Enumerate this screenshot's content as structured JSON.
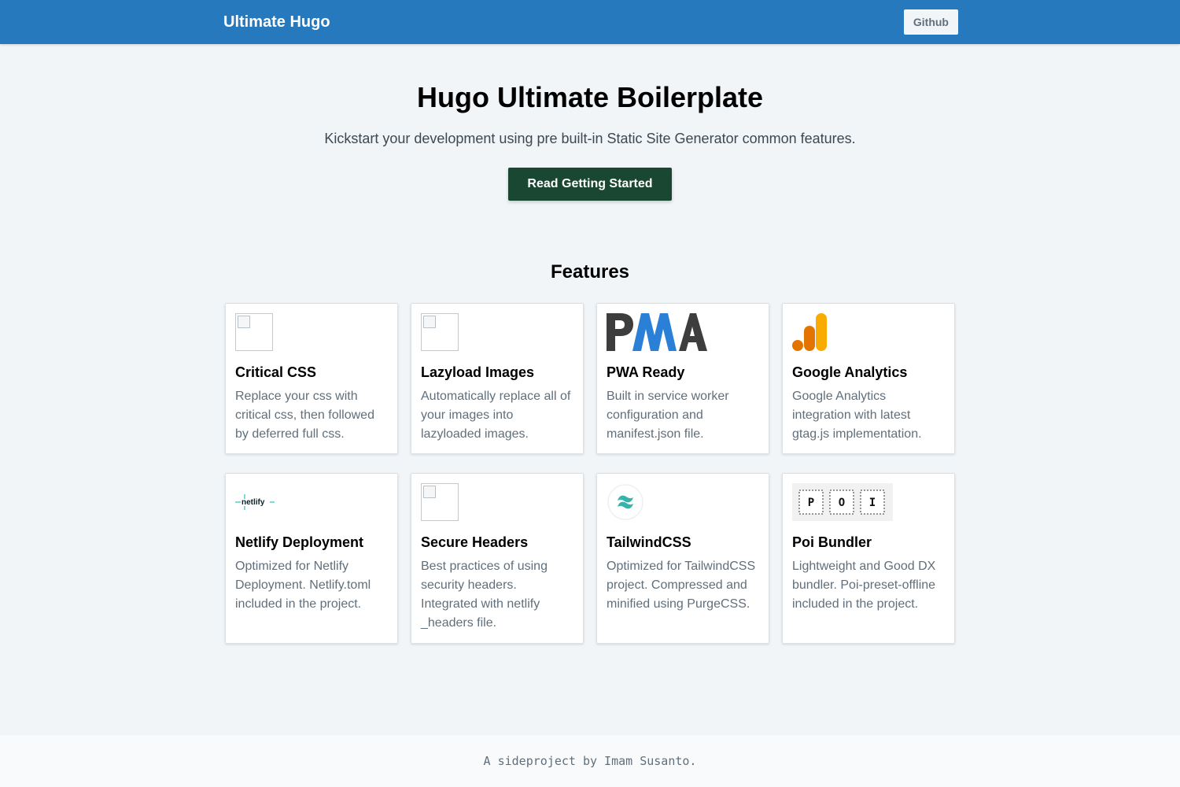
{
  "header": {
    "brand": "Ultimate Hugo",
    "github_label": "Github"
  },
  "hero": {
    "title": "Hugo Ultimate Boilerplate",
    "subtitle": "Kickstart your development using pre built-in Static Site Generator common features.",
    "cta_label": "Read Getting Started"
  },
  "features": {
    "heading": "Features",
    "items": [
      {
        "icon": "broken-image-icon",
        "title": "Critical CSS",
        "description": "Replace your css with critical css, then followed by deferred full css."
      },
      {
        "icon": "broken-image-icon",
        "title": "Lazyload Images",
        "description": "Automatically replace all of your images into lazyloaded images."
      },
      {
        "icon": "pwa-logo-icon",
        "title": "PWA Ready",
        "description": "Built in service worker configuration and manifest.json file."
      },
      {
        "icon": "google-analytics-icon",
        "title": "Google Analytics",
        "description": "Google Analytics integration with latest gtag.js implementation."
      },
      {
        "icon": "netlify-logo-icon",
        "title": "Netlify Deployment",
        "description": "Optimized for Netlify Deployment. Netlify.toml included in the project."
      },
      {
        "icon": "broken-image-icon",
        "title": "Secure Headers",
        "description": "Best practices of using security headers. Integrated with netlify _headers file."
      },
      {
        "icon": "tailwind-logo-icon",
        "title": "TailwindCSS",
        "description": "Optimized for TailwindCSS project. Compressed and minified using PurgeCSS."
      },
      {
        "icon": "poi-logo-icon",
        "title": "Poi Bundler",
        "description": "Lightweight and Good DX bundler. Poi-preset-offline included in the project."
      }
    ]
  },
  "logos": {
    "netlify_text": "netlify",
    "poi_letters": [
      "P",
      "O",
      "I"
    ]
  },
  "footer": {
    "text": "A sideproject by Imam Susanto."
  },
  "colors": {
    "navbar": "#2779bd",
    "cta": "#1a4731",
    "background": "#f1f5f8"
  }
}
